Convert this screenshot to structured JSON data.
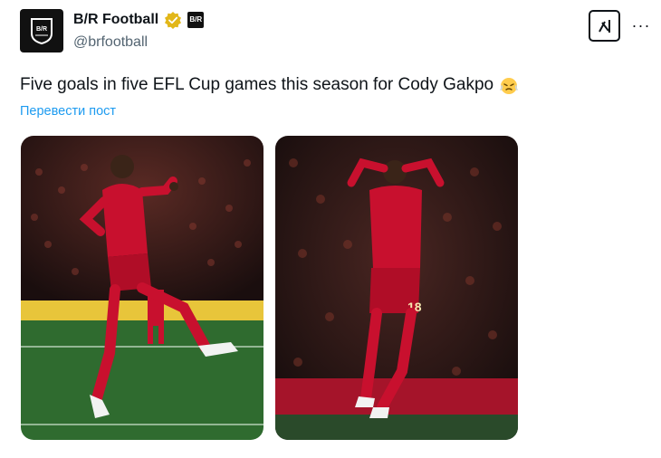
{
  "account": {
    "display_name": "B/R Football",
    "handle": "@brfootball",
    "affiliate_badge": "B/R",
    "avatar_icon": "br-shield-logo",
    "verified_icon": "gold-verified-badge"
  },
  "header_actions": {
    "grok_icon": "grok-icon",
    "more_icon": "more-dots-icon",
    "more_label": "···"
  },
  "tweet": {
    "text": "Five goals in five EFL Cup games this season for Cody Gakpo",
    "emoji_icon": "steaming-face-emoji",
    "translate_label": "Перевести пост"
  },
  "media": [
    {
      "alt_icon": "player-celebration-photo",
      "shirt_number": ""
    },
    {
      "alt_icon": "player-celebration-photo",
      "shirt_number": "18"
    }
  ],
  "colors": {
    "link": "#1d9bf0",
    "text": "#0f1419",
    "muted": "#536471",
    "kit_red": "#c8102e",
    "pitch": "#2f6b2f"
  }
}
